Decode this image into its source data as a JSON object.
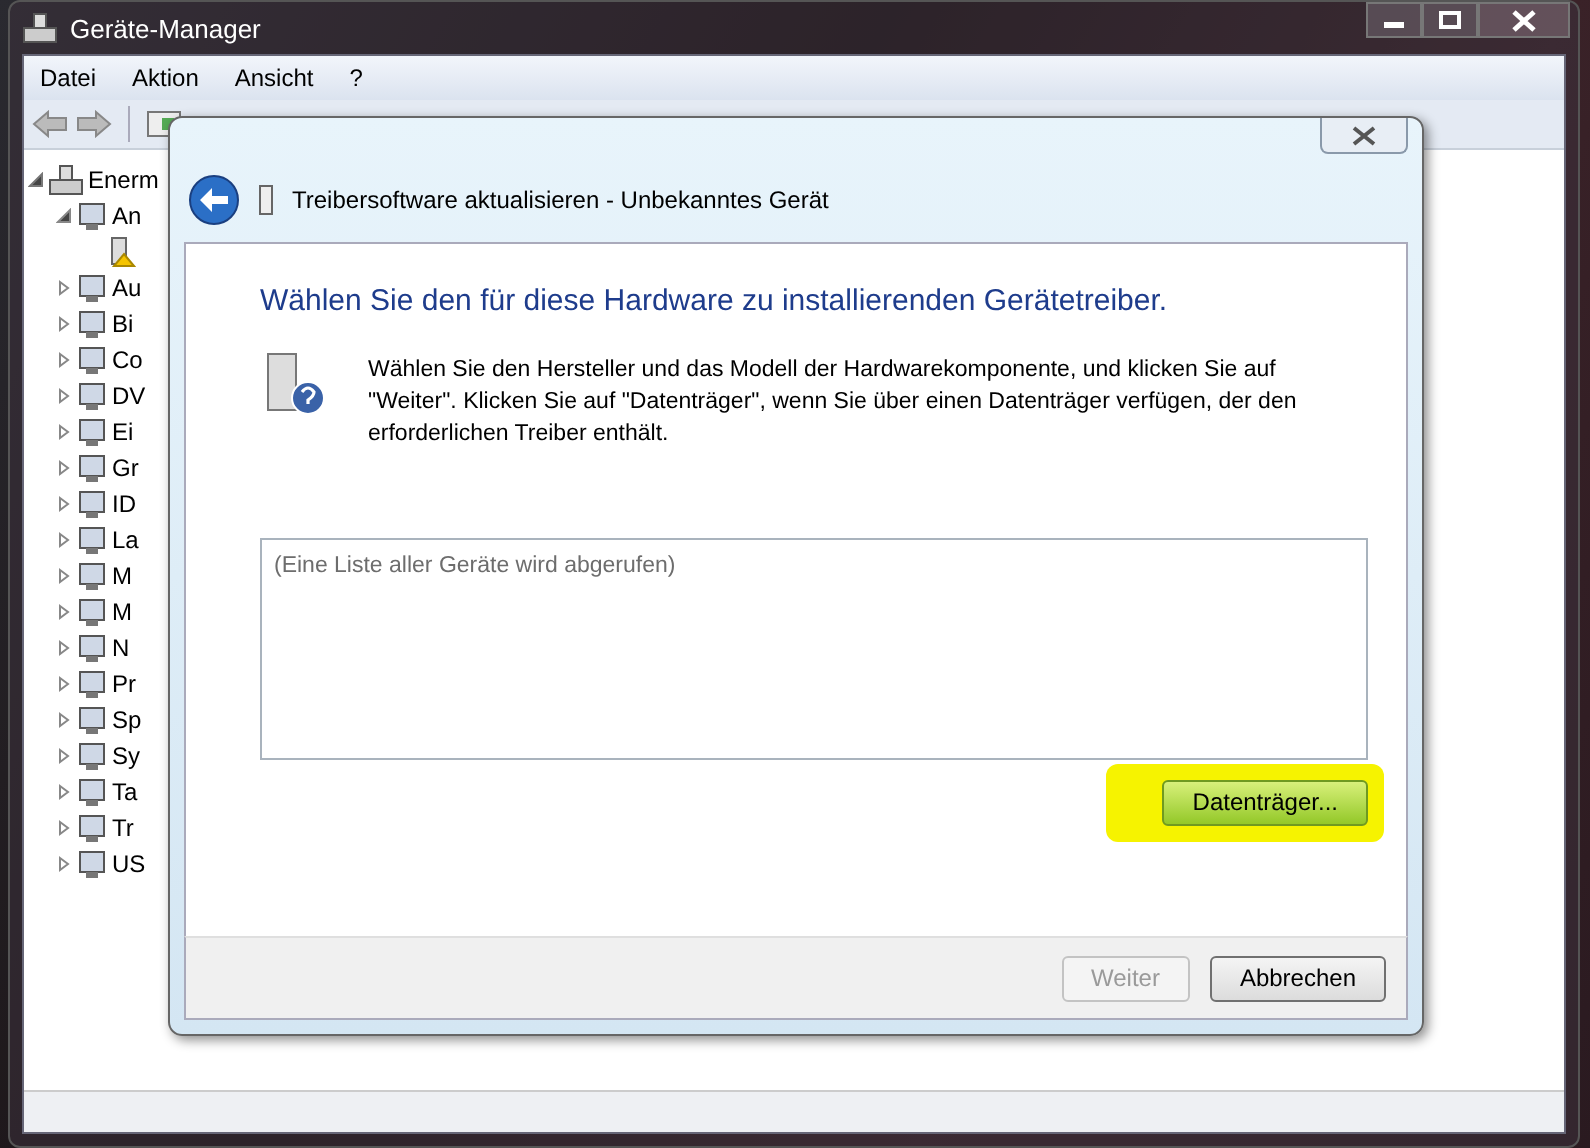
{
  "window": {
    "title": "Geräte-Manager"
  },
  "menu": [
    "Datei",
    "Aktion",
    "Ansicht",
    "?"
  ],
  "tree": {
    "label": "Enerm",
    "expanded": true,
    "children": [
      {
        "label": "An",
        "expanded": true,
        "children": [
          {
            "warning": true
          }
        ]
      },
      {
        "label": "Au",
        "expanded": false
      },
      {
        "label": "Bi",
        "expanded": false
      },
      {
        "label": "Co",
        "expanded": false
      },
      {
        "label": "DV",
        "expanded": false
      },
      {
        "label": "Ei",
        "expanded": false
      },
      {
        "label": "Gr",
        "expanded": false
      },
      {
        "label": "ID",
        "expanded": false
      },
      {
        "label": "La",
        "expanded": false
      },
      {
        "label": "M",
        "expanded": false
      },
      {
        "label": "M",
        "expanded": false
      },
      {
        "label": "N",
        "expanded": false
      },
      {
        "label": "Pr",
        "expanded": false
      },
      {
        "label": "Sp",
        "expanded": false
      },
      {
        "label": "Sy",
        "expanded": false
      },
      {
        "label": "Ta",
        "expanded": false
      },
      {
        "label": "Tr",
        "expanded": false
      },
      {
        "label": "US",
        "expanded": false
      }
    ]
  },
  "dialog": {
    "title": "Treibersoftware aktualisieren - Unbekanntes Gerät",
    "heading": "Wählen Sie den für diese Hardware zu installierenden Gerätetreiber.",
    "text": "Wählen Sie den Hersteller und das Modell der Hardwarekomponente, und klicken Sie auf \"Weiter\". Klicken Sie auf \"Datenträger\", wenn Sie über einen Datenträger verfügen, der den erforderlichen Treiber enthält.",
    "list_placeholder": "(Eine Liste aller Geräte wird abgerufen)",
    "disk_button": {
      "label": "Datenträger...",
      "highlighted": true
    },
    "buttons": [
      {
        "label": "Weiter",
        "disabled": true
      },
      {
        "label": "Abbrechen",
        "disabled": false
      }
    ]
  }
}
